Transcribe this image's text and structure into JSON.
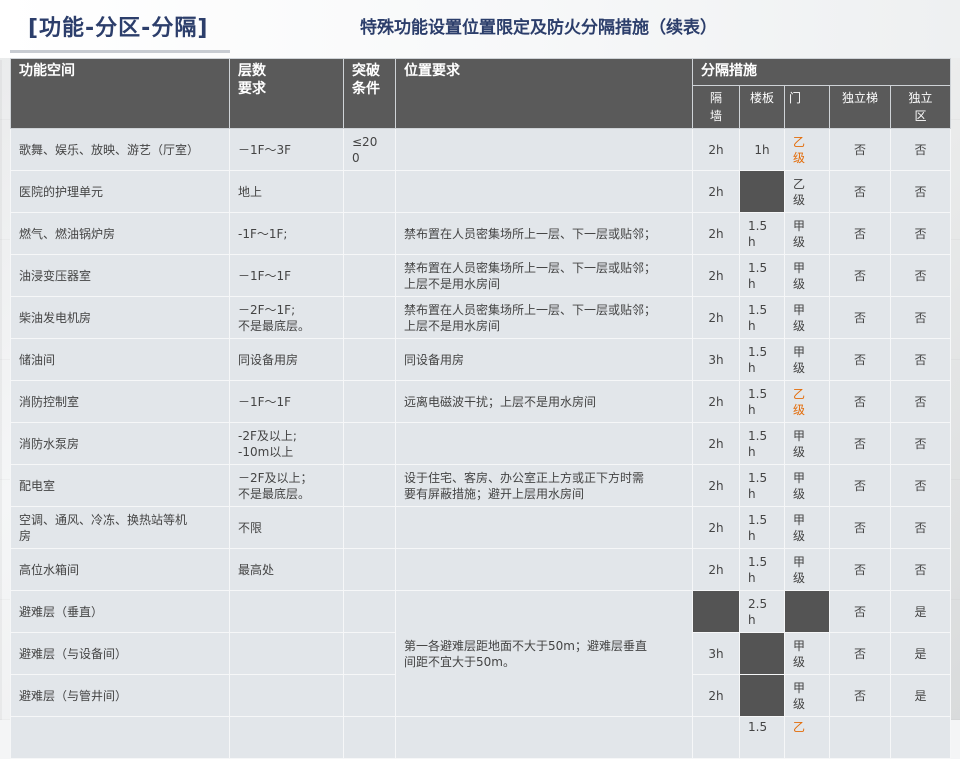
{
  "header": {
    "section_tag": "[功能-分区-分隔]",
    "title": "特殊功能设置位置限定及防火分隔措施（续表）"
  },
  "table": {
    "headers": {
      "space": "功能空间",
      "floor": "层数\n要求",
      "exceed": "突破\n条件",
      "position": "位置要求",
      "separation": "分隔措施"
    },
    "sub_headers": {
      "wall": "隔\n墙",
      "floor_slab": "楼板",
      "door": "门",
      "stair": "独立梯",
      "zone": "独立\n区"
    },
    "rows": [
      {
        "space": "歌舞、娱乐、放映、游艺（厅室）",
        "floor": " －1F～3F",
        "exceed": "≤20\n0",
        "position": "",
        "wall": "2h",
        "slab": "1h",
        "door": "乙\n级",
        "stair": "否",
        "zone": "否"
      },
      {
        "space": "医院的护理单元",
        "floor": "地上",
        "exceed": "",
        "position": "",
        "wall": "2h",
        "slab": "",
        "door": "乙\n级",
        "stair": "否",
        "zone": "否"
      },
      {
        "space": "燃气、燃油锅炉房",
        "floor": "-1F～1F;",
        "exceed": "",
        "position": "禁布置在人员密集场所上一层、下一层或贴邻；",
        "wall": "2h",
        "slab": "1.5\nh",
        "door": "甲\n级",
        "stair": "否",
        "zone": "否"
      },
      {
        "space": "油浸变压器室",
        "floor": " －1F～1F",
        "exceed": "",
        "position": "禁布置在人员密集场所上一层、下一层或贴邻；\n上层不是用水房间",
        "wall": "2h",
        "slab": "1.5\nh",
        "door": "甲\n级",
        "stair": "否",
        "zone": "否"
      },
      {
        "space": "柴油发电机房",
        "floor": " －2F～1F;\n不是最底层。",
        "exceed": "",
        "position": "禁布置在人员密集场所上一层、下一层或贴邻；\n上层不是用水房间",
        "wall": "2h",
        "slab": "1.5\nh",
        "door": "甲\n级",
        "stair": "否",
        "zone": "否"
      },
      {
        "space": "储油间",
        "floor": "同设备用房",
        "exceed": "",
        "position": "同设备用房",
        "wall": "3h",
        "slab": "1.5\nh",
        "door": "甲\n级",
        "stair": "否",
        "zone": "否"
      },
      {
        "space": "消防控制室",
        "floor": " －1F～1F",
        "exceed": "",
        "position": "远离电磁波干扰；上层不是用水房间",
        "wall": "2h",
        "slab": "1.5\nh",
        "door": "乙\n级",
        "stair": "否",
        "zone": "否"
      },
      {
        "space": "消防水泵房",
        "floor": "-2F及以上;\n-10m以上",
        "exceed": "",
        "position": "",
        "wall": "2h",
        "slab": "1.5\nh",
        "door": "甲\n级",
        "stair": "否",
        "zone": "否"
      },
      {
        "space": "配电室",
        "floor": " －2F及以上；\n不是最底层。",
        "exceed": "",
        "position": "设于住宅、客房、办公室正上方或正下方时需\n要有屏蔽措施；避开上层用水房间",
        "wall": "2h",
        "slab": "1.5\nh",
        "door": "甲\n级",
        "stair": "否",
        "zone": "否"
      },
      {
        "space": "空调、通风、冷冻、换热站等机\n房",
        "floor": "不限",
        "exceed": "",
        "position": "",
        "wall": "2h",
        "slab": "1.5\nh",
        "door": "甲\n级",
        "stair": "否",
        "zone": "否"
      },
      {
        "space": "高位水箱间",
        "floor": "最高处",
        "exceed": "",
        "position": "",
        "wall": "2h",
        "slab": "1.5\nh",
        "door": "甲\n级",
        "stair": "否",
        "zone": "否"
      },
      {
        "space": "避难层（垂直）",
        "floor": "",
        "exceed": "",
        "wall": "",
        "slab": "2.5\nh",
        "door": "",
        "stair": "否",
        "zone": "是"
      },
      {
        "space": "避难层（与设备间）",
        "floor": "",
        "exceed": "",
        "wall": "3h",
        "slab": "",
        "door": "甲\n级",
        "stair": "否",
        "zone": "是"
      },
      {
        "space": "避难层（与管井间）",
        "floor": "",
        "exceed": "",
        "wall": "2h",
        "slab": "",
        "door": "甲\n级",
        "stair": "否",
        "zone": "是"
      },
      {
        "space": "",
        "floor": "",
        "exceed": "",
        "position": "",
        "wall": "",
        "slab": "1.5",
        "door": "乙",
        "stair": "",
        "zone": ""
      }
    ],
    "refuge_position": "第一各避难层距地面不大于50m；避难层垂直\n间距不宜大于50m。"
  },
  "colors": {
    "title_blue": "#2c3e6b",
    "header_gray": "#5a5a5a",
    "cell_bg": "#e2e6ea",
    "dark_cell": "#545454",
    "class_b_orange": "#e36c09"
  }
}
